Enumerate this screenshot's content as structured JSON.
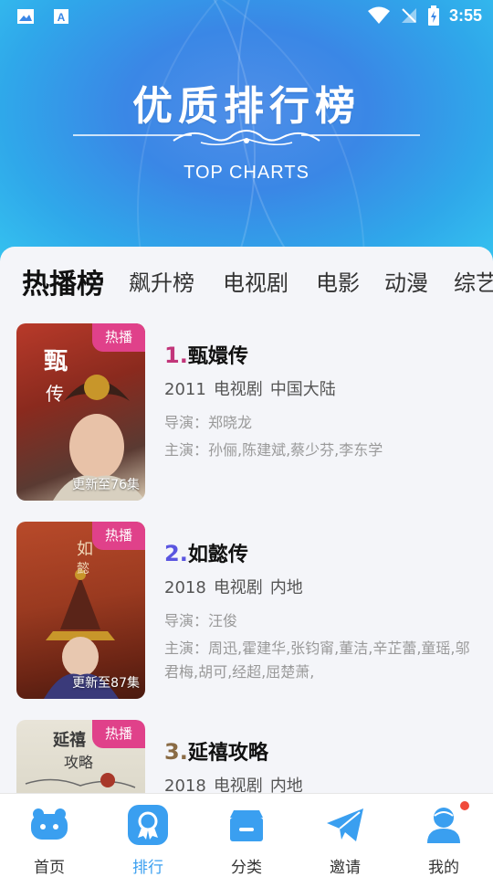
{
  "status_bar": {
    "time": "3:55"
  },
  "header": {
    "title": "优质排行榜",
    "subtitle": "TOP CHARTS"
  },
  "tabs": [
    {
      "label": "热播榜",
      "active": true
    },
    {
      "label": "飙升榜",
      "active": false
    },
    {
      "label": "电视剧",
      "active": false
    },
    {
      "label": "电影",
      "active": false
    },
    {
      "label": "动漫",
      "active": false
    },
    {
      "label": "综艺",
      "active": false
    }
  ],
  "items": [
    {
      "rank": "1.",
      "rank_color": "#c2357a",
      "name": "甄嬛传",
      "year": "2011",
      "type": "电视剧",
      "region": "中国大陆",
      "director": "导演：郑晓龙",
      "cast": "主演：孙俪,陈建斌,蔡少芬,李东学",
      "badge": "热播",
      "update": "更新至76集",
      "poster_text": "甄嬛传"
    },
    {
      "rank": "2.",
      "rank_color": "#5a55e0",
      "name": "如懿传",
      "year": "2018",
      "type": "电视剧",
      "region": "内地",
      "director": "导演：汪俊",
      "cast": "主演：周迅,霍建华,张钧甯,董洁,辛芷蕾,童瑶,邬君梅,胡可,经超,屈楚萧,",
      "badge": "热播",
      "update": "更新至87集",
      "poster_text": "如懿传"
    },
    {
      "rank": "3.",
      "rank_color": "#8a6b45",
      "name": "延禧攻略",
      "year": "2018",
      "type": "电视剧",
      "region": "内地",
      "badge": "热播",
      "poster_text": "延禧攻略"
    }
  ],
  "bottom_nav": [
    {
      "label": "首页",
      "icon": "home-icon",
      "active": false
    },
    {
      "label": "排行",
      "icon": "rank-icon",
      "active": true
    },
    {
      "label": "分类",
      "icon": "category-icon",
      "active": false
    },
    {
      "label": "邀请",
      "icon": "invite-icon",
      "active": false
    },
    {
      "label": "我的",
      "icon": "profile-icon",
      "active": false
    }
  ],
  "colors": {
    "accent": "#3a9ff0",
    "badge": "#e0418a",
    "nav_dot": "#f04a3a"
  }
}
